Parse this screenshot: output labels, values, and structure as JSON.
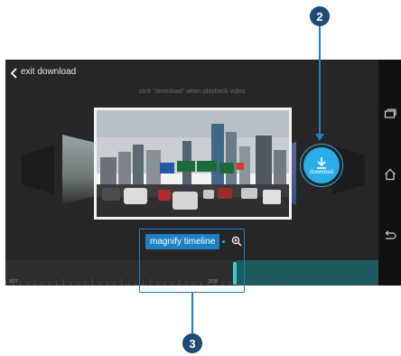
{
  "topbar": {
    "exit_label": "exit download"
  },
  "hint": "click \"download\" when playback video",
  "download": {
    "label": "download"
  },
  "magnify": {
    "label": "magnify timeline"
  },
  "timeline": {
    "start_label": "3/27",
    "mid_label": "3/28",
    "handle_position_fraction": 0.61
  },
  "callouts": {
    "download_badge": "2",
    "timeline_badge": "3"
  },
  "colors": {
    "accent": "#2aaeea",
    "callout": "#1e7fc4",
    "badge": "#1f4a74",
    "timeline_fill": "#1f5b5c"
  },
  "icons": {
    "back": "chevron-left-icon",
    "download": "download-arrow-icon",
    "magnify": "zoom-in-icon",
    "recent_apps": "recent-apps-icon",
    "home": "home-icon",
    "system_back": "back-arrow-icon"
  }
}
